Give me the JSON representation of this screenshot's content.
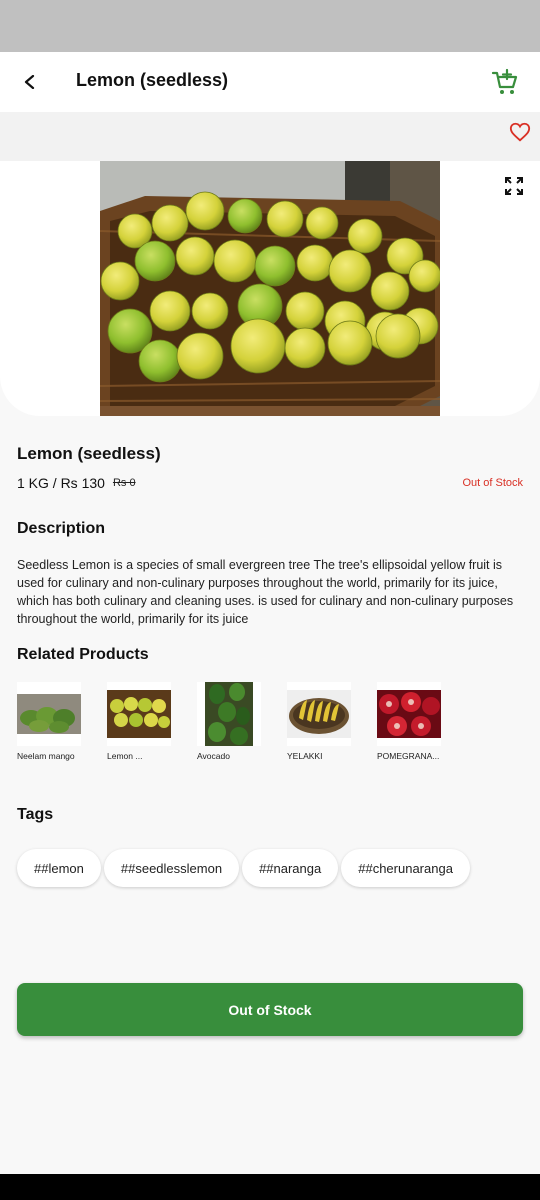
{
  "header": {
    "title": "Lemon (seedless)",
    "back_icon": "back-arrow-icon",
    "cart_icon": "add-to-cart-icon"
  },
  "favorite_icon": "heart-outline-icon",
  "expand_icon": "fullscreen-icon",
  "product": {
    "name": "Lemon (seedless)",
    "price": "1 KG / Rs 130",
    "original_price": "Rs 0",
    "stock_status": "Out of Stock"
  },
  "description": {
    "title": "Description",
    "text": "Seedless Lemon is a species of small evergreen tree The tree's ellipsoidal yellow fruit is used for culinary and non-culinary purposes throughout the world, primarily for its juice, which has both culinary and cleaning uses. is used for culinary and non-culinary purposes throughout the world, primarily for its juice"
  },
  "related": {
    "title": "Related Products",
    "items": [
      {
        "label": "Neelam mango"
      },
      {
        "label": "Lemon ..."
      },
      {
        "label": "Avocado"
      },
      {
        "label": "YELAKKI"
      },
      {
        "label": "POMEGRANA..."
      }
    ]
  },
  "tags": {
    "title": "Tags",
    "items": [
      "##lemon",
      "##seedlesslemon",
      "##naranga",
      "##cherunaranga"
    ]
  },
  "cta": {
    "label": "Out of Stock"
  },
  "colors": {
    "primary": "#388e3c",
    "out_of_stock": "#d93025",
    "background": "#f8f8f8"
  }
}
